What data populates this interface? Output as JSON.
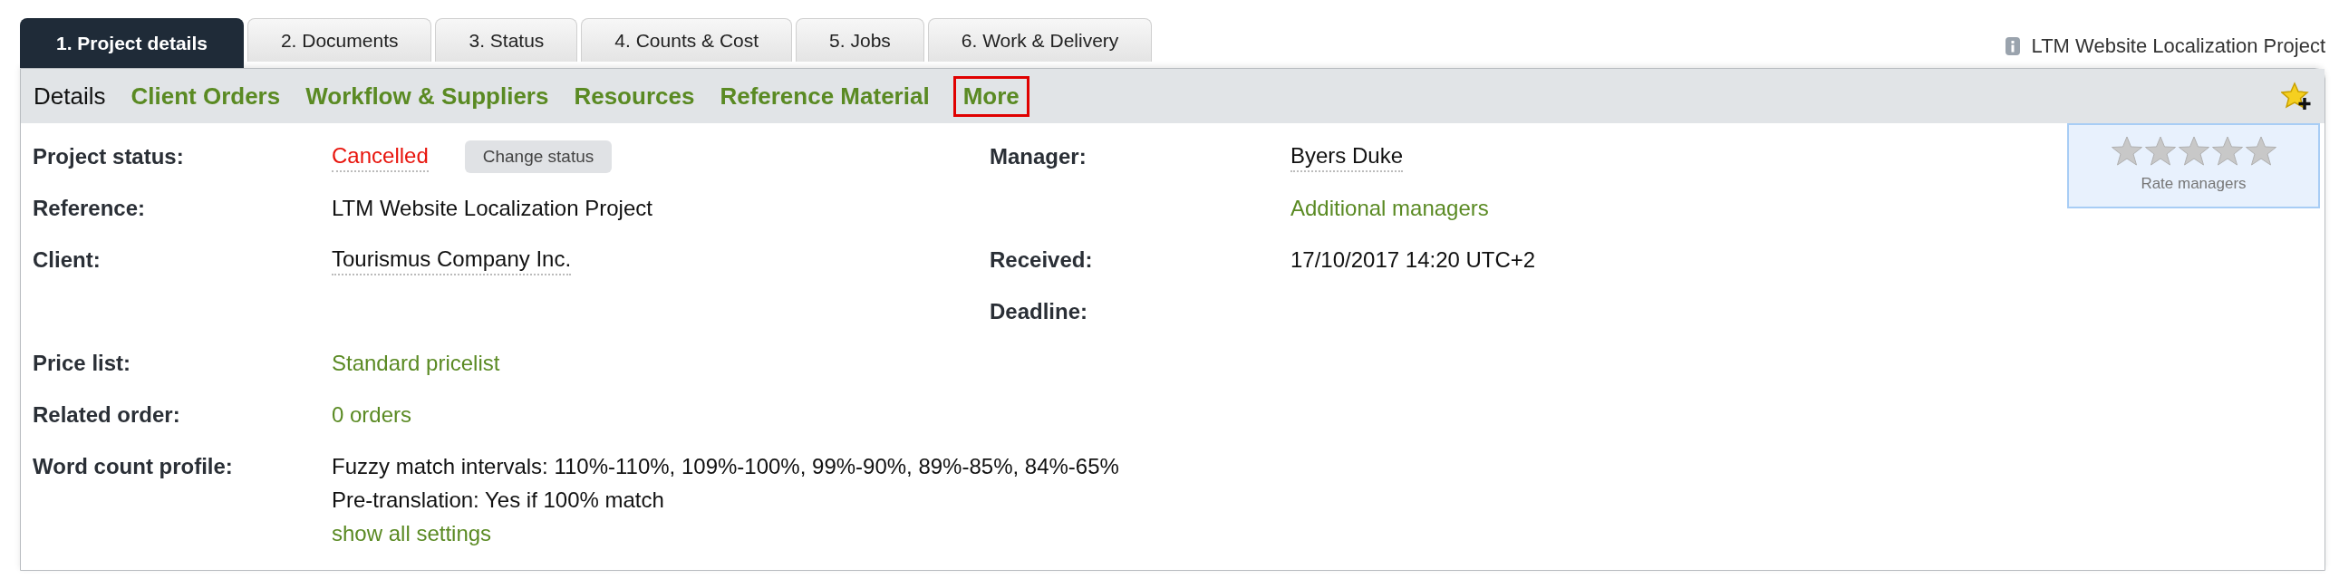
{
  "tabs": [
    {
      "label": "1. Project details",
      "selected": true
    },
    {
      "label": "2. Documents",
      "selected": false
    },
    {
      "label": "3. Status",
      "selected": false
    },
    {
      "label": "4. Counts & Cost",
      "selected": false
    },
    {
      "label": "5. Jobs",
      "selected": false
    },
    {
      "label": "6. Work & Delivery",
      "selected": false
    }
  ],
  "project_title": "LTM Website Localization Project",
  "subnav": [
    {
      "label": "Details",
      "selected": true,
      "highlighted": false
    },
    {
      "label": "Client Orders",
      "selected": false,
      "highlighted": false
    },
    {
      "label": "Workflow & Suppliers",
      "selected": false,
      "highlighted": false
    },
    {
      "label": "Resources",
      "selected": false,
      "highlighted": false
    },
    {
      "label": "Reference Material",
      "selected": false,
      "highlighted": false
    },
    {
      "label": "More",
      "selected": false,
      "highlighted": true
    }
  ],
  "rating": {
    "stars": 0,
    "label": "Rate managers"
  },
  "rows": [
    {
      "left": {
        "label": "Project status:",
        "value": "Cancelled",
        "kind": "status",
        "button": "Change status"
      },
      "right": {
        "label": "Manager:",
        "value": "Byers Duke",
        "kind": "entity"
      }
    },
    {
      "left": {
        "label": "Reference:",
        "value": "LTM Website Localization Project",
        "kind": "text"
      },
      "right": {
        "value": "Additional managers",
        "kind": "link"
      }
    },
    {
      "left": {
        "label": "Client:",
        "value": "Tourismus Company Inc.",
        "kind": "entity"
      },
      "right": {
        "label": "Received:",
        "value": "17/10/2017 14:20 UTC+2",
        "kind": "text"
      }
    },
    {
      "right": {
        "label": "Deadline:"
      }
    },
    {
      "left": {
        "label": "Price list:",
        "value": "Standard pricelist",
        "kind": "link"
      }
    },
    {
      "left": {
        "label": "Related order:",
        "value": "0 orders",
        "kind": "link"
      }
    },
    {
      "left": {
        "label": "Word count profile:",
        "lines": [
          "Fuzzy match intervals: 110%-110%, 109%-100%, 99%-90%, 89%-85%, 84%-65%",
          "Pre-translation: Yes if 100% match"
        ],
        "link": "show all settings"
      }
    }
  ]
}
